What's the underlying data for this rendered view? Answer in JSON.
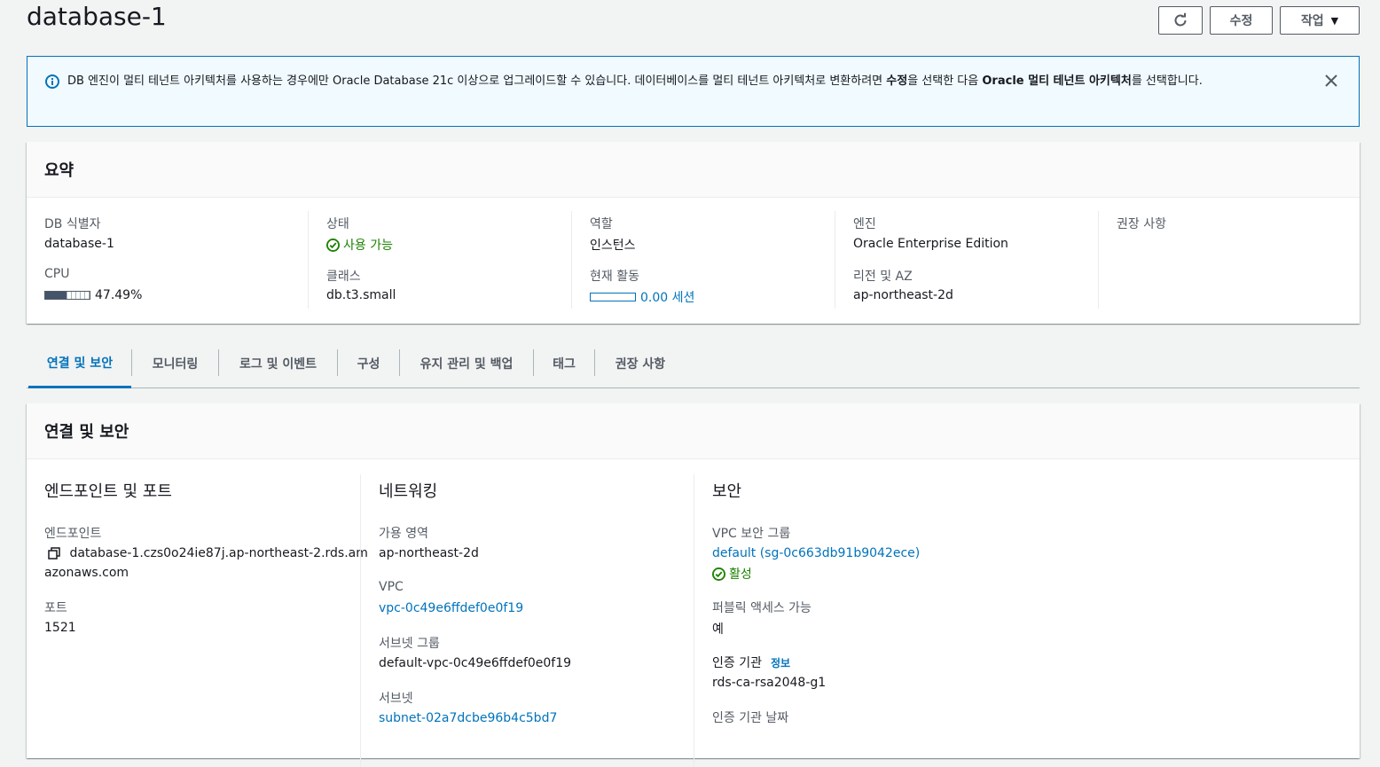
{
  "header": {
    "title": "database-1",
    "edit_label": "수정",
    "actions_label": "작업"
  },
  "alert": {
    "text_part1": "DB 엔진이 멀티 테넌트 아키텍처를 사용하는 경우에만 Oracle Database 21c 이상으로 업그레이드할 수 있습니다. 데이터베이스를 멀티 테넌트 아키텍처로 변환하려면 ",
    "bold_edit": "수정",
    "text_part2": "을 선택한 다음 ",
    "bold_arch": "Oracle 멀티 테넌트 아키텍처",
    "text_part3": "를 선택합니다."
  },
  "summary": {
    "title": "요약",
    "db_id_label": "DB 식별자",
    "db_id_value": "database-1",
    "cpu_label": "CPU",
    "cpu_value": "47.49%",
    "cpu_fraction": 0.4749,
    "status_label": "상태",
    "status_value": "사용 가능",
    "class_label": "클래스",
    "class_value": "db.t3.small",
    "role_label": "역할",
    "role_value": "인스턴스",
    "activity_label": "현재 활동",
    "activity_value": "0.00 세션",
    "engine_label": "엔진",
    "engine_value": "Oracle Enterprise Edition",
    "region_label": "리전 및 AZ",
    "region_value": "ap-northeast-2d",
    "recommend_label": "권장 사항"
  },
  "tabs": [
    {
      "label": "연결 및 보안"
    },
    {
      "label": "모니터링"
    },
    {
      "label": "로그 및 이벤트"
    },
    {
      "label": "구성"
    },
    {
      "label": "유지 관리 및 백업"
    },
    {
      "label": "태그"
    },
    {
      "label": "권장 사항"
    }
  ],
  "connectivity": {
    "title": "연결 및 보안",
    "endpoint_section": {
      "title": "엔드포인트 및 포트",
      "endpoint_label": "엔드포인트",
      "endpoint_line1": "database-1.czs0o24ie87j.ap-northeast-2.rds.am",
      "endpoint_line2": "azonaws.com",
      "port_label": "포트",
      "port_value": "1521"
    },
    "network_section": {
      "title": "네트워킹",
      "az_label": "가용 영역",
      "az_value": "ap-northeast-2d",
      "vpc_label": "VPC",
      "vpc_value": "vpc-0c49e6ffdef0e0f19",
      "subnet_group_label": "서브넷 그룹",
      "subnet_group_value": "default-vpc-0c49e6ffdef0e0f19",
      "subnets_label": "서브넷",
      "subnet_value": "subnet-02a7dcbe96b4c5bd7"
    },
    "security_section": {
      "title": "보안",
      "sg_label": "VPC 보안 그룹",
      "sg_value": "default (sg-0c663db91b9042ece)",
      "sg_status": "활성",
      "public_label": "퍼블릭 액세스 가능",
      "public_value": "예",
      "ca_label": "인증 기관",
      "ca_info": "정보",
      "ca_value": "rds-ca-rsa2048-g1",
      "ca_date_label": "인증 기관 날짜"
    }
  }
}
